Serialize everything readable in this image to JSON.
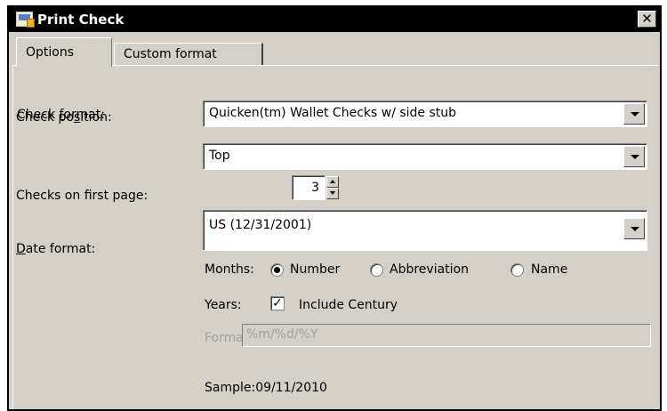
{
  "window": {
    "title": "Print Check",
    "close_symbol": "✕"
  },
  "tabs": [
    {
      "label": "Options",
      "active": true
    },
    {
      "label": "Custom format",
      "active": false
    }
  ],
  "form": {
    "check_format": {
      "label_pre": "Check ",
      "label_key": "f",
      "label_post": "ormat:",
      "value": "Quicken(tm) Wallet Checks w/ side stub"
    },
    "check_position": {
      "label_pre": "Check po",
      "label_key": "s",
      "label_post": "ition:",
      "value": "Top"
    },
    "checks_first_page": {
      "label": "Checks on first page:",
      "value": "3"
    },
    "date_format": {
      "label_key": "D",
      "label_post": "ate format:",
      "value": "US (12/31/2001)"
    },
    "months": {
      "label": "Months:",
      "options": [
        "Number",
        "Abbreviation",
        "Name"
      ],
      "selected": "Number"
    },
    "years": {
      "label": "Years:",
      "checkbox_label": "Include Century",
      "checked": true,
      "check_mark": "✓"
    },
    "format": {
      "label": "Format:",
      "value": "%m/%d/%Y"
    },
    "sample": {
      "label": "Sample:",
      "value": "09/11/2010"
    }
  },
  "icons": {
    "app": "print-check-app-icon",
    "close": "close-icon",
    "dropdown": "chevron-down-icon",
    "spin_up": "spin-up-icon",
    "spin_down": "spin-down-icon"
  }
}
